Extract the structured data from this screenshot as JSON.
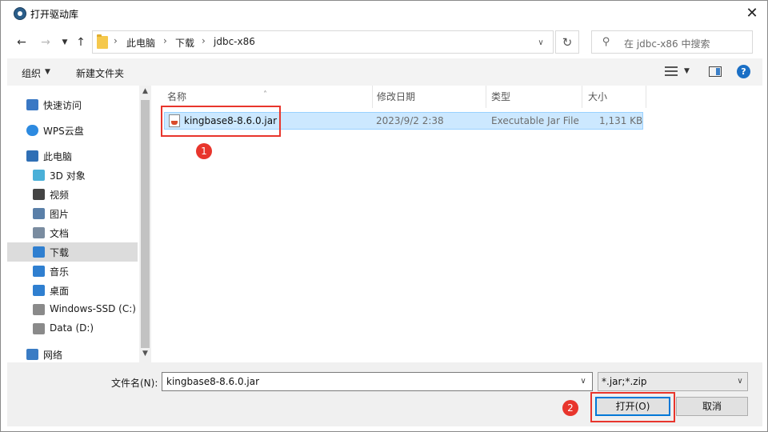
{
  "title": "打开驱动库",
  "breadcrumb": [
    "此电脑",
    "下载",
    "jdbc-x86"
  ],
  "search": {
    "placeholder": "在 jdbc-x86 中搜索"
  },
  "toolbar": {
    "organize_label": "组织",
    "new_folder_label": "新建文件夹",
    "help_label": "?"
  },
  "nav_items": [
    {
      "label": "快速访问",
      "icon": "star-icon"
    },
    {
      "label": "WPS云盘",
      "icon": "cloud-icon"
    },
    {
      "label": "此电脑",
      "icon": "computer-icon"
    },
    {
      "label": "3D 对象",
      "icon": "cube-icon"
    },
    {
      "label": "视频",
      "icon": "video-icon"
    },
    {
      "label": "图片",
      "icon": "picture-icon"
    },
    {
      "label": "文档",
      "icon": "document-icon"
    },
    {
      "label": "下载",
      "icon": "download-icon",
      "selected": true
    },
    {
      "label": "音乐",
      "icon": "music-icon"
    },
    {
      "label": "桌面",
      "icon": "desktop-icon"
    },
    {
      "label": "Windows-SSD (C:)",
      "icon": "drive-icon"
    },
    {
      "label": "Data (D:)",
      "icon": "drive-icon"
    },
    {
      "label": "网络",
      "icon": "network-icon"
    }
  ],
  "columns": {
    "name": "名称",
    "date": "修改日期",
    "type": "类型",
    "size": "大小"
  },
  "files": [
    {
      "name": "kingbase8-8.6.0.jar",
      "date": "2023/9/2 2:38",
      "type": "Executable Jar File",
      "size": "1,131 KB",
      "selected": true
    }
  ],
  "annotations": {
    "step1": "1",
    "step2": "2"
  },
  "bottom": {
    "filename_label": "文件名(N):",
    "filename_value": "kingbase8-8.6.0.jar",
    "filter_value": "*.jar;*.zip",
    "open_label": "打开(O)",
    "cancel_label": "取消"
  },
  "colors": {
    "selection": "#cce8ff",
    "annotation": "#e8352c",
    "accent": "#0078d7"
  }
}
